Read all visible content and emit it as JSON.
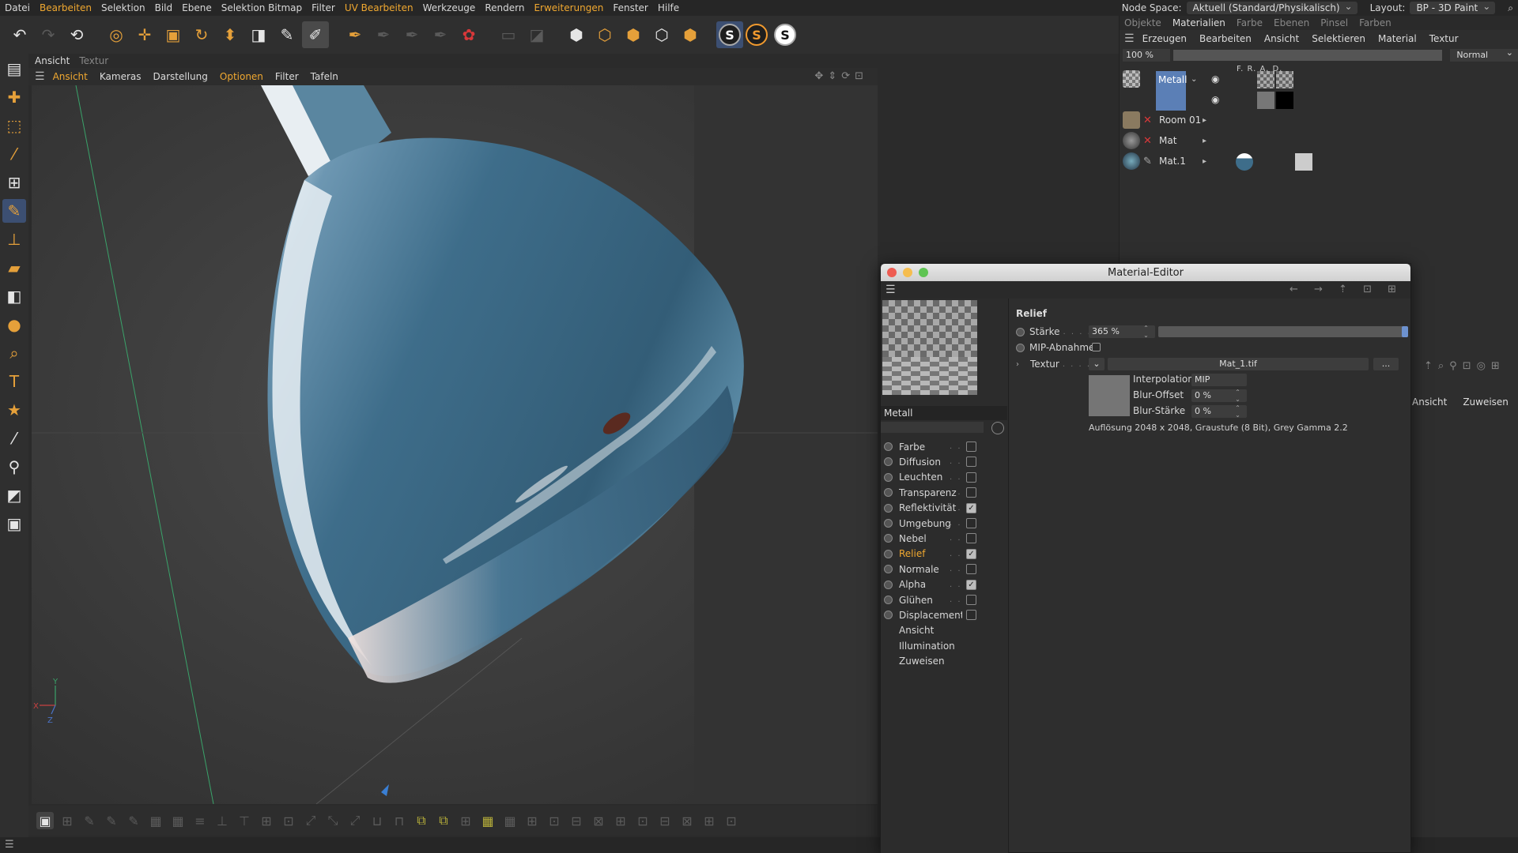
{
  "menubar": {
    "items": [
      {
        "label": "Datei",
        "hl": false
      },
      {
        "label": "Bearbeiten",
        "hl": true
      },
      {
        "label": "Selektion",
        "hl": false
      },
      {
        "label": "Bild",
        "hl": false
      },
      {
        "label": "Ebene",
        "hl": false
      },
      {
        "label": "Selektion Bitmap",
        "hl": false
      },
      {
        "label": "Filter",
        "hl": false
      },
      {
        "label": "UV Bearbeiten",
        "hl": true
      },
      {
        "label": "Werkzeuge",
        "hl": false
      },
      {
        "label": "Rendern",
        "hl": false
      },
      {
        "label": "Erweiterungen",
        "hl": true
      },
      {
        "label": "Fenster",
        "hl": false
      },
      {
        "label": "Hilfe",
        "hl": false
      }
    ],
    "node_space_label": "Node Space:",
    "node_space_value": "Aktuell (Standard/Physikalisch)",
    "layout_label": "Layout:",
    "layout_value": "BP - 3D Paint"
  },
  "viewport": {
    "tabs": [
      "Ansicht",
      "Textur"
    ],
    "menu": [
      {
        "label": "Ansicht",
        "hl": true
      },
      {
        "label": "Kameras",
        "hl": false
      },
      {
        "label": "Darstellung",
        "hl": false
      },
      {
        "label": "Optionen",
        "hl": true
      },
      {
        "label": "Filter",
        "hl": false
      },
      {
        "label": "Tafeln",
        "hl": false
      }
    ],
    "axis_y": "Y",
    "axis_x": "X",
    "axis_z": "Z"
  },
  "rightpanel": {
    "tabs": [
      {
        "label": "Objekte",
        "on": false
      },
      {
        "label": "Materialien",
        "on": true
      },
      {
        "label": "Farbe",
        "on": false
      },
      {
        "label": "Ebenen",
        "on": false
      },
      {
        "label": "Pinsel",
        "on": false
      },
      {
        "label": "Farben",
        "on": false
      }
    ],
    "menu": [
      "Erzeugen",
      "Bearbeiten",
      "Ansicht",
      "Selektieren",
      "Material",
      "Textur"
    ],
    "zoom": "100 %",
    "blend_mode": "Normal",
    "columns": "F.  R.  A.  D.",
    "layers": [
      "Metall",
      "Room 01",
      "Mat",
      "Mat.1"
    ],
    "btn_ansicht": "Ansicht",
    "btn_zuweisen": "Zuweisen"
  },
  "editor": {
    "title": "Material-Editor",
    "material_name": "Metall",
    "channels": [
      {
        "label": "Farbe",
        "checked": false,
        "active": false
      },
      {
        "label": "Diffusion",
        "checked": false,
        "active": false
      },
      {
        "label": "Leuchten",
        "checked": false,
        "active": false
      },
      {
        "label": "Transparenz",
        "checked": false,
        "active": false
      },
      {
        "label": "Reflektivität",
        "checked": true,
        "active": false
      },
      {
        "label": "Umgebung",
        "checked": false,
        "active": false
      },
      {
        "label": "Nebel",
        "checked": false,
        "active": false
      },
      {
        "label": "Relief",
        "checked": true,
        "active": true
      },
      {
        "label": "Normale",
        "checked": false,
        "active": false
      },
      {
        "label": "Alpha",
        "checked": true,
        "active": false
      },
      {
        "label": "Glühen",
        "checked": false,
        "active": false
      },
      {
        "label": "Displacement",
        "checked": false,
        "active": false
      }
    ],
    "extra": [
      "Ansicht",
      "Illumination",
      "Zuweisen"
    ],
    "section": "Relief",
    "staerke_label": "Stärke",
    "staerke_value": "365 %",
    "staerke_fraction": 1.0,
    "mip_label": "MIP-Abnahme",
    "textur_label": "Textur",
    "textur_file": "Mat_1.tif",
    "textur_more": "...",
    "interpolation_label": "Interpolation",
    "interpolation_value": "MIP",
    "blur_offset_label": "Blur-Offset",
    "blur_offset_value": "0 %",
    "blur_staerke_label": "Blur-Stärke",
    "blur_staerke_value": "0 %",
    "info": "Auflösung 2048 x 2048, Graustufe (8 Bit), Grey Gamma 2.2"
  },
  "colors": {
    "accent": "#f0a830",
    "selection": "#5b7fb6",
    "model": "#3f6b86"
  }
}
